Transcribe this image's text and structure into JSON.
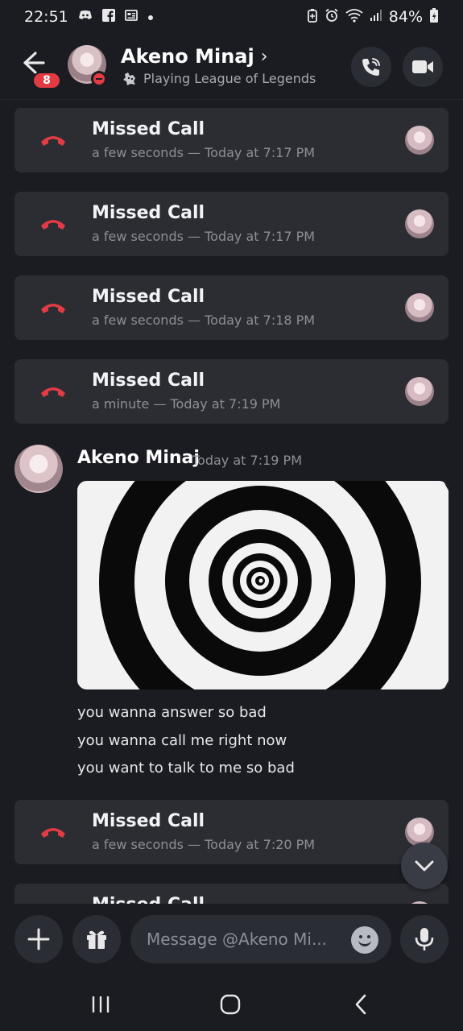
{
  "status_bar": {
    "time": "22:51",
    "battery": "84%",
    "left_icons": [
      "discord-icon",
      "facebook-icon",
      "news-icon",
      "dot-icon"
    ],
    "right_icons": [
      "battery-saver-icon",
      "alarm-icon",
      "wifi-icon",
      "signal-icon",
      "battery-icon"
    ]
  },
  "header": {
    "unread_count": "8",
    "name": "Akeno Minaj",
    "chevron": "›",
    "activity": "Playing League of Legends",
    "status_color": "#e23b43"
  },
  "call_cards": [
    {
      "title": "Missed Call",
      "meta": "a few seconds — Today at 7:17 PM"
    },
    {
      "title": "Missed Call",
      "meta": "a few seconds — Today at 7:17 PM"
    },
    {
      "title": "Missed Call",
      "meta": "a few seconds — Today at 7:18 PM"
    },
    {
      "title": "Missed Call",
      "meta": "a minute — Today at 7:19 PM"
    },
    {
      "title": "Missed Call",
      "meta": "a few seconds — Today at 7:20 PM"
    },
    {
      "title": "Missed Call",
      "meta": ""
    }
  ],
  "message": {
    "author": "Akeno Minaj",
    "time": "Today at 7:19 PM",
    "lines": [
      "you wanna answer so bad",
      "you wanna call me right now",
      "you want to talk to me so bad"
    ]
  },
  "input": {
    "placeholder": "Message @Akeno Mi..."
  },
  "colors": {
    "background": "#1b1c22",
    "card": "#2b2d33",
    "missed_call_red": "#e23b43"
  }
}
